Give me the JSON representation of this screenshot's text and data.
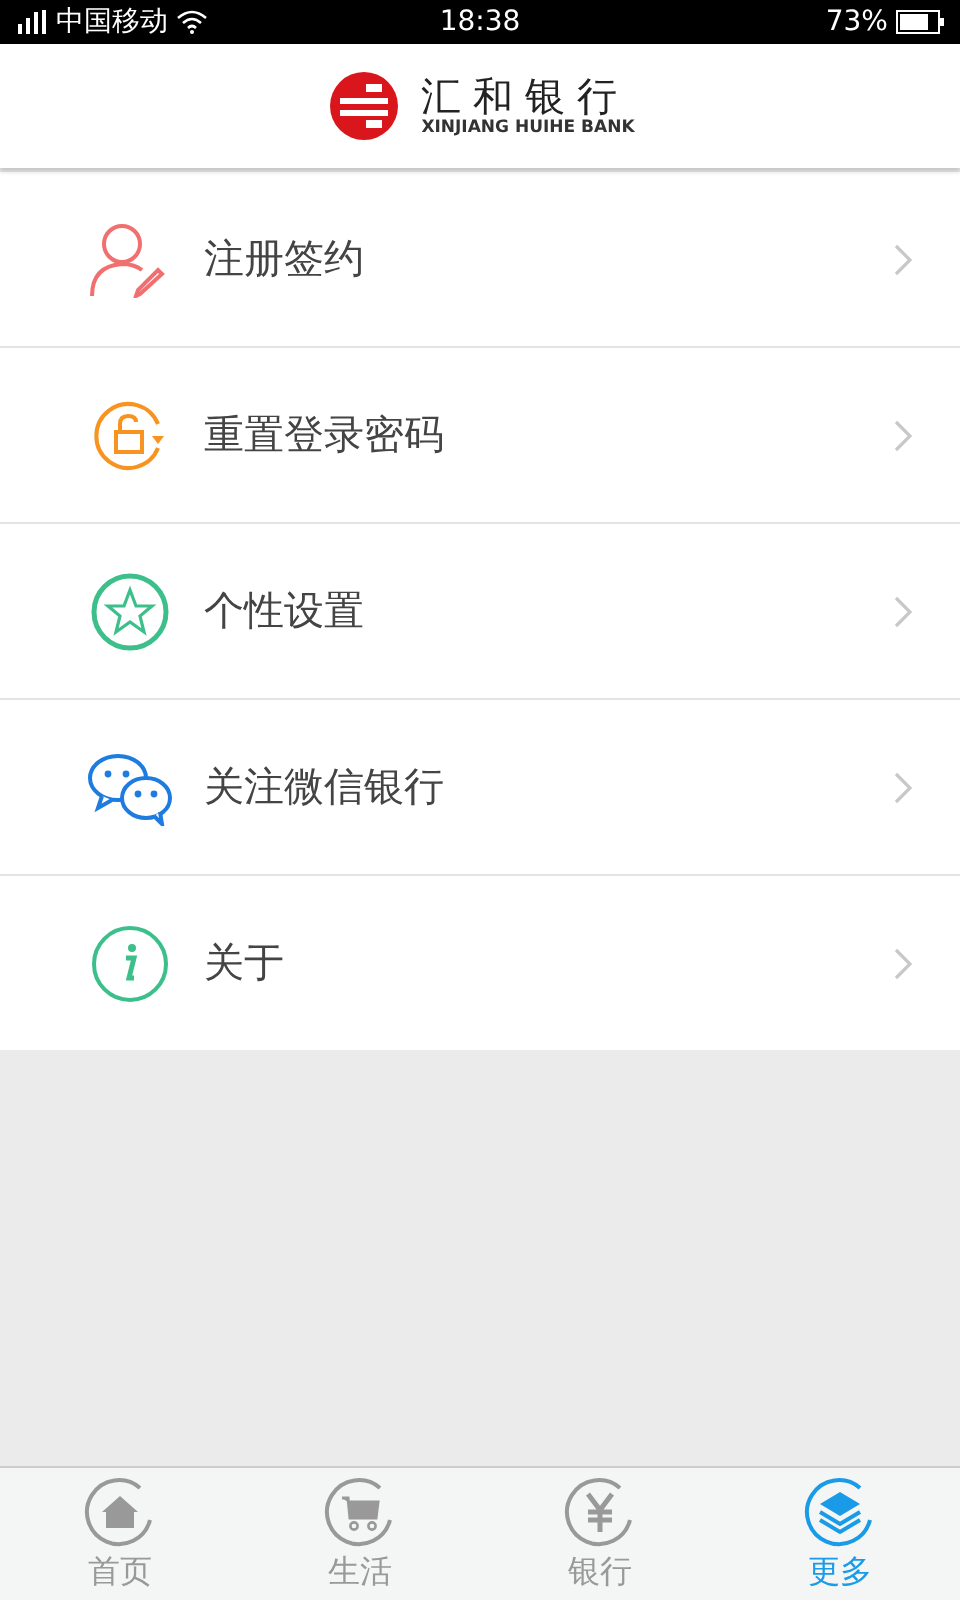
{
  "status_bar": {
    "carrier": "中国移动",
    "time": "18:38",
    "battery": "73%"
  },
  "header": {
    "logo_name": "汇和银行",
    "logo_subtitle": "XINJIANG HUIHE BANK"
  },
  "menu": [
    {
      "kind": "user",
      "label": "注册签约"
    },
    {
      "kind": "unlock",
      "label": "重置登录密码"
    },
    {
      "kind": "star",
      "label": "个性设置"
    },
    {
      "kind": "wechat",
      "label": "关注微信银行"
    },
    {
      "kind": "info",
      "label": "关于"
    }
  ],
  "tabs": [
    {
      "kind": "home",
      "label": "首页",
      "selected": false
    },
    {
      "kind": "cart",
      "label": "生活",
      "selected": false
    },
    {
      "kind": "yen",
      "label": "银行",
      "selected": false
    },
    {
      "kind": "layers",
      "label": "更多",
      "selected": true
    }
  ]
}
